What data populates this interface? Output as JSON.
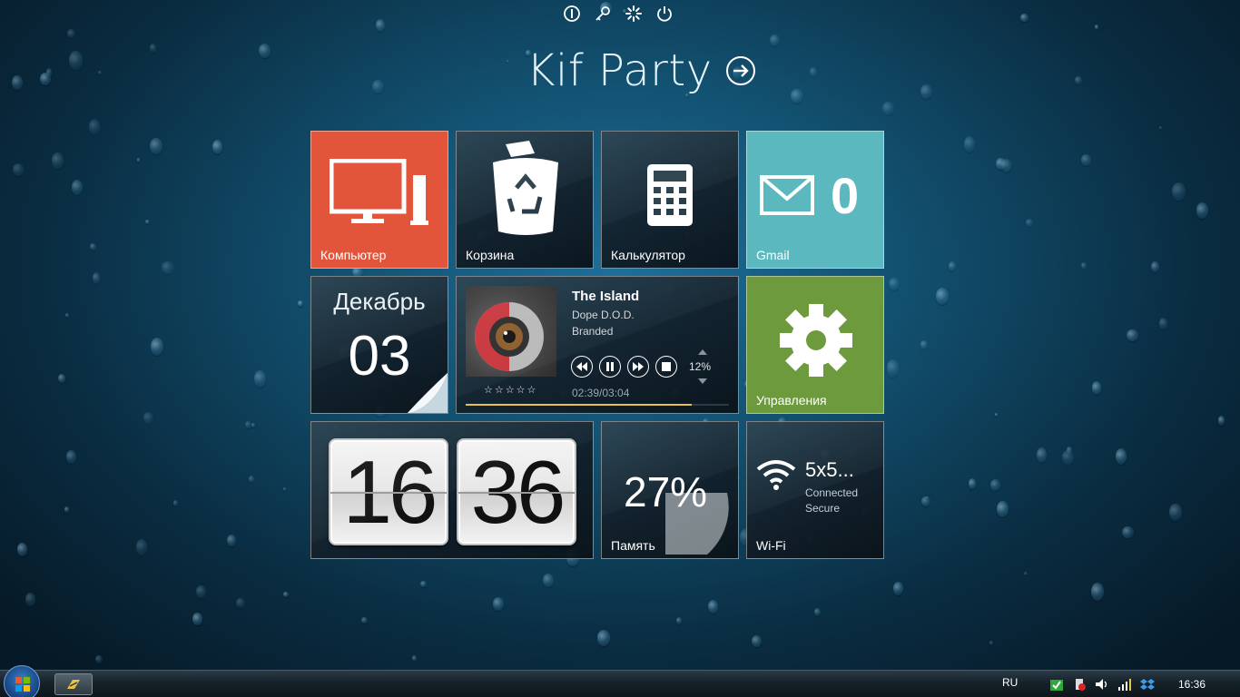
{
  "header": {
    "user_name": "Kif Party",
    "icons": [
      "info-icon",
      "key-icon",
      "accessibility-icon",
      "power-icon"
    ]
  },
  "tiles": {
    "computer": {
      "label": "Компьютер",
      "color": "#e2553a"
    },
    "recycle": {
      "label": "Корзина"
    },
    "calculator": {
      "label": "Калькулятор"
    },
    "gmail": {
      "label": "Gmail",
      "count": "0",
      "color": "#5cb8bf"
    },
    "calendar": {
      "month": "Декабрь",
      "day": "03"
    },
    "music": {
      "title": "The Island",
      "artist": "Dope D.O.D.",
      "album": "Branded",
      "volume": "12%",
      "rating": "☆☆☆☆☆",
      "time": "02:39/03:04",
      "progress": 0.86
    },
    "settings": {
      "label": "Управления",
      "color": "#6e9a3e"
    },
    "clock": {
      "hours": "16",
      "minutes": "36"
    },
    "memory": {
      "label": "Память",
      "percent": "27%"
    },
    "wifi": {
      "label": "Wi-Fi",
      "ssid": "5x5...",
      "status": "Connected",
      "security": "Secure"
    }
  },
  "taskbar": {
    "language": "RU",
    "time": "16:36",
    "tray_icons": [
      "download-check-icon",
      "usb-icon",
      "volume-icon",
      "signal-icon",
      "dropbox-icon"
    ]
  }
}
